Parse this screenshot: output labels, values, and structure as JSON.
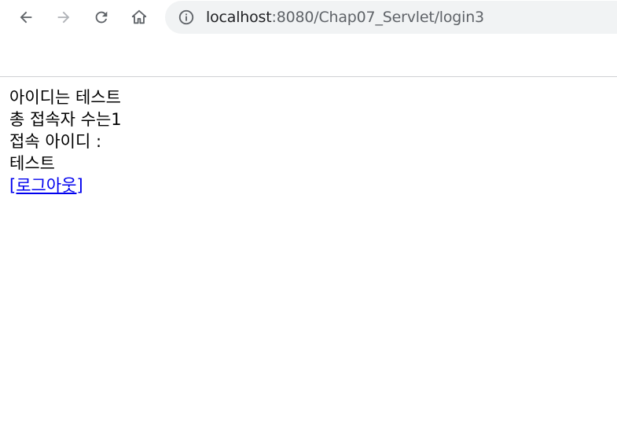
{
  "browser": {
    "url_host": "localhost",
    "url_rest": ":8080/Chap07_Servlet/login3",
    "icons": {
      "back": "arrow-left-icon",
      "forward": "arrow-right-icon",
      "reload": "reload-icon",
      "home": "home-icon",
      "site_info": "info-circle-icon"
    }
  },
  "page": {
    "line1": "아이디는 테스트",
    "line2": "총 접속자 수는1",
    "line3": "접속 아이디 :",
    "line4": "테스트",
    "logout_link": "[로그아웃]"
  },
  "colors": {
    "link": "#0000ee",
    "omnibox_bg": "#f1f3f4",
    "icon_active": "#5f6368",
    "icon_disabled": "#b0b3b8"
  }
}
